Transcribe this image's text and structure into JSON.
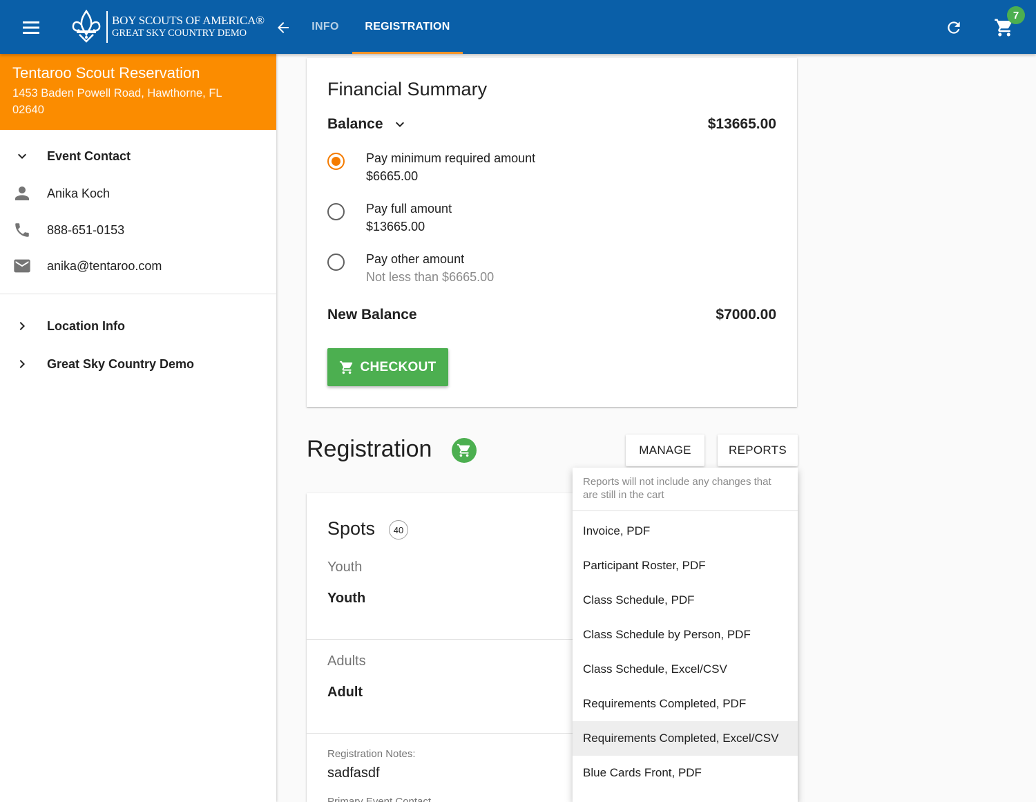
{
  "header": {
    "logo_line1": "BOY SCOUTS OF AMERICA®",
    "logo_line2": "GREAT SKY COUNTRY DEMO",
    "tabs": [
      {
        "label": "INFO",
        "active": false
      },
      {
        "label": "REGISTRATION",
        "active": true
      }
    ],
    "cart_count": "7",
    "colors": {
      "bar": "#0a5fa8",
      "tab_indicator": "#f79428",
      "badge": "#4caf50"
    }
  },
  "sidebar": {
    "venue_name": "Tentaroo Scout Reservation",
    "venue_address": "1453 Baden Powell Road, Hawthorne, FL 02640",
    "event_contact": {
      "heading": "Event Contact",
      "name": "Anika Koch",
      "phone": "888-651-0153",
      "email": "anika@tentaroo.com"
    },
    "sections": [
      {
        "label": "Location Info"
      },
      {
        "label": "Great Sky Country Demo"
      }
    ],
    "colors": {
      "venue_bg": "#fb8c00"
    }
  },
  "financial": {
    "title": "Financial Summary",
    "balance_label": "Balance",
    "balance_value": "$13665.00",
    "options": [
      {
        "label": "Pay minimum required amount",
        "amount": "$6665.00",
        "selected": true
      },
      {
        "label": "Pay full amount",
        "amount": "$13665.00",
        "selected": false
      },
      {
        "label": "Pay other amount",
        "hint": "Not less than $6665.00",
        "selected": false
      }
    ],
    "new_balance_label": "New Balance",
    "new_balance_value": "$7000.00",
    "checkout_label": "CHECKOUT",
    "colors": {
      "radio_selected": "#f57c00",
      "checkout_bg": "#4caf50"
    }
  },
  "registration": {
    "title": "Registration",
    "manage_label": "MANAGE",
    "reports_label": "REPORTS",
    "spots_title": "Spots",
    "spots_count": "40",
    "youth_label": "Youth",
    "youth_value": "Youth",
    "adults_label": "Adults",
    "adults_value": "Adult",
    "notes_label": "Registration Notes:",
    "notes_value": "sadfasdf",
    "next_label": "Primary Event Contact"
  },
  "reports_menu": {
    "note": "Reports will not include any changes that are still in the cart",
    "items": [
      {
        "label": "Invoice, PDF"
      },
      {
        "label": "Participant Roster, PDF"
      },
      {
        "label": "Class Schedule, PDF"
      },
      {
        "label": "Class Schedule by Person, PDF"
      },
      {
        "label": "Class Schedule, Excel/CSV"
      },
      {
        "label": "Requirements Completed, PDF"
      },
      {
        "label": "Requirements Completed, Excel/CSV",
        "hovered": true
      },
      {
        "label": "Blue Cards Front, PDF"
      }
    ]
  }
}
